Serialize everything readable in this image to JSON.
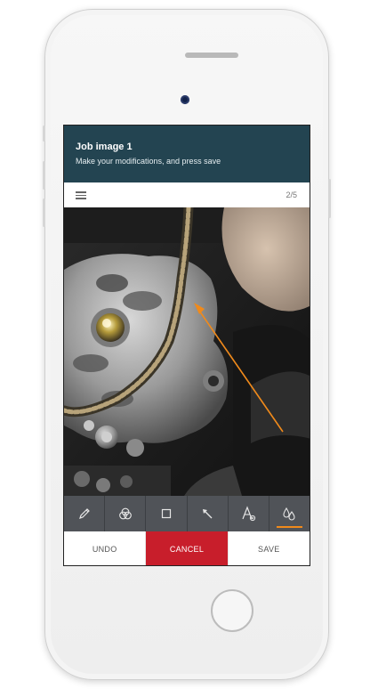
{
  "header": {
    "title": "Job image 1",
    "subtitle": "Make your modifications, and press save"
  },
  "toolbar": {
    "menu_icon": "hamburger-icon",
    "page_counter": "2/5"
  },
  "photo": {
    "description_icon": "engine-photo",
    "annotation_color": "#f08a1b"
  },
  "tools": [
    {
      "name": "pencil-icon",
      "active": false
    },
    {
      "name": "color-circles-icon",
      "active": false
    },
    {
      "name": "rectangle-icon",
      "active": false
    },
    {
      "name": "arrow-icon",
      "active": false
    },
    {
      "name": "text-icon",
      "active": false
    },
    {
      "name": "drops-icon",
      "active": true
    }
  ],
  "actions": {
    "undo": "UNDO",
    "cancel": "CANCEL",
    "save": "SAVE"
  },
  "colors": {
    "header_bg": "#234451",
    "cancel_bg": "#c81e2b",
    "tools_bg": "#505358",
    "accent": "#f08a1b"
  }
}
